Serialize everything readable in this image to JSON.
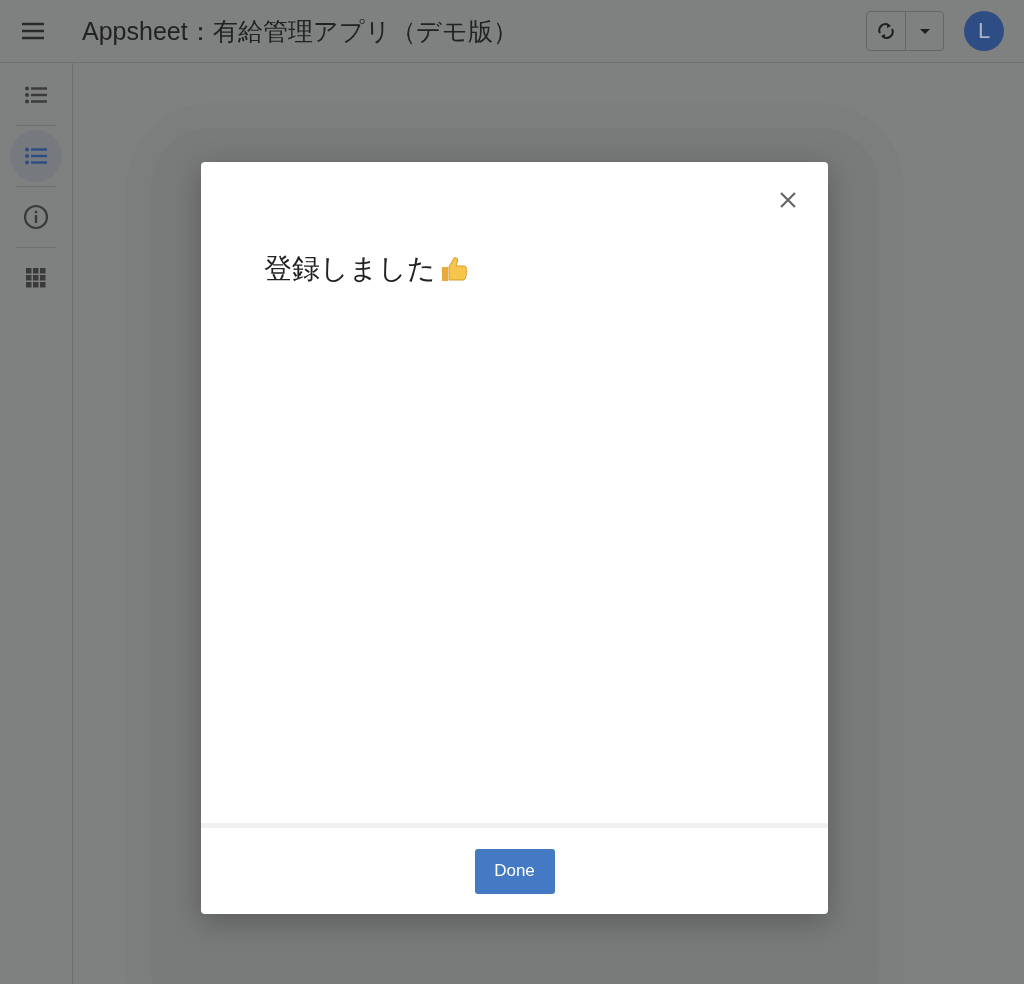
{
  "app_bar": {
    "title": "Appsheet：有給管理アプリ（デモ版）",
    "avatar": "L"
  },
  "sidebar": {
    "items": [
      {
        "kind": "list",
        "selected": false
      },
      {
        "kind": "list",
        "selected": true
      },
      {
        "kind": "info",
        "selected": false
      },
      {
        "kind": "grid",
        "selected": false
      }
    ]
  },
  "dialog": {
    "message": "登録しました",
    "button": "Done"
  }
}
